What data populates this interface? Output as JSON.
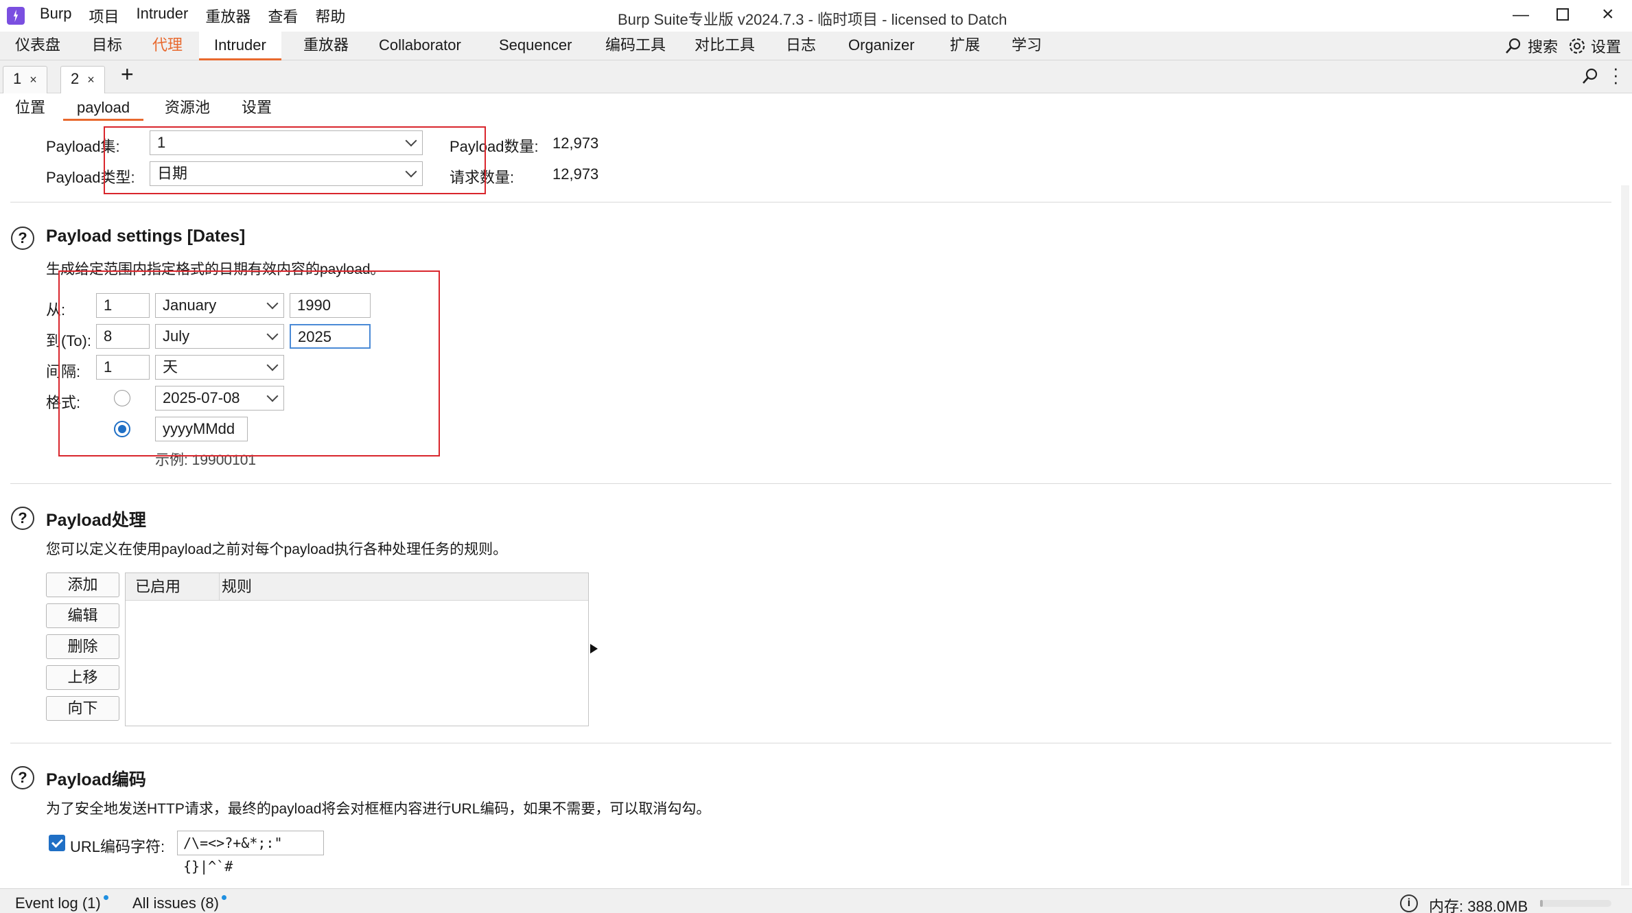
{
  "titlebar": {
    "menu": [
      "Burp",
      "项目",
      "Intruder",
      "重放器",
      "查看",
      "帮助"
    ],
    "window_title": "Burp Suite专业版  v2024.7.3 - 临时项目 - licensed to Datch"
  },
  "main_tabs": [
    "仪表盘",
    "目标",
    "代理",
    "Intruder",
    "重放器",
    "Collaborator",
    "Sequencer",
    "编码工具",
    "对比工具",
    "日志",
    "Organizer",
    "扩展",
    "学习"
  ],
  "top_right": {
    "search": "搜索",
    "settings": "设置"
  },
  "attack_tabs": [
    {
      "label": "1"
    },
    {
      "label": "2"
    }
  ],
  "inner_tabs": [
    "位置",
    "payload",
    "资源池",
    "设置"
  ],
  "payload_sets": {
    "set_label": "Payload集:",
    "set_value": "1",
    "type_label": "Payload类型:",
    "type_value": "日期",
    "count_label": "Payload数量:",
    "count_value": "12,973",
    "requests_label": "请求数量:",
    "requests_value": "12,973"
  },
  "settings": {
    "heading": "Payload settings [Dates]",
    "description": "生成给定范围内指定格式的日期有效内容的payload。",
    "from_label": "从:",
    "from_day": "1",
    "from_month": "January",
    "from_year": "1990",
    "to_label": "到(To):",
    "to_day": "8",
    "to_month": "July",
    "to_year": "2025",
    "interval_label": "间隔:",
    "interval_value": "1",
    "interval_unit": "天",
    "format_label": "格式:",
    "format_preset": "2025-07-08",
    "format_custom": "yyyyMMdd",
    "example": "示例: 19900101"
  },
  "processing": {
    "heading": "Payload处理",
    "description": "您可以定义在使用payload之前对每个payload执行各种处理任务的规则。",
    "buttons": [
      "添加",
      "编辑",
      "删除",
      "上移",
      "向下"
    ],
    "columns": [
      "已启用",
      "规则"
    ]
  },
  "encoding": {
    "heading": "Payload编码",
    "description": "为了安全地发送HTTP请求，最终的payload将会对框框内容进行URL编码，如果不需要，可以取消勾勾。",
    "checkbox_label": "URL编码字符:",
    "chars": "/\\=<>?+&*;:\"{}|^`#"
  },
  "statusbar": {
    "event_log": "Event log (1)",
    "all_issues": "All issues (8)",
    "memory": "内存: 388.0MB"
  }
}
